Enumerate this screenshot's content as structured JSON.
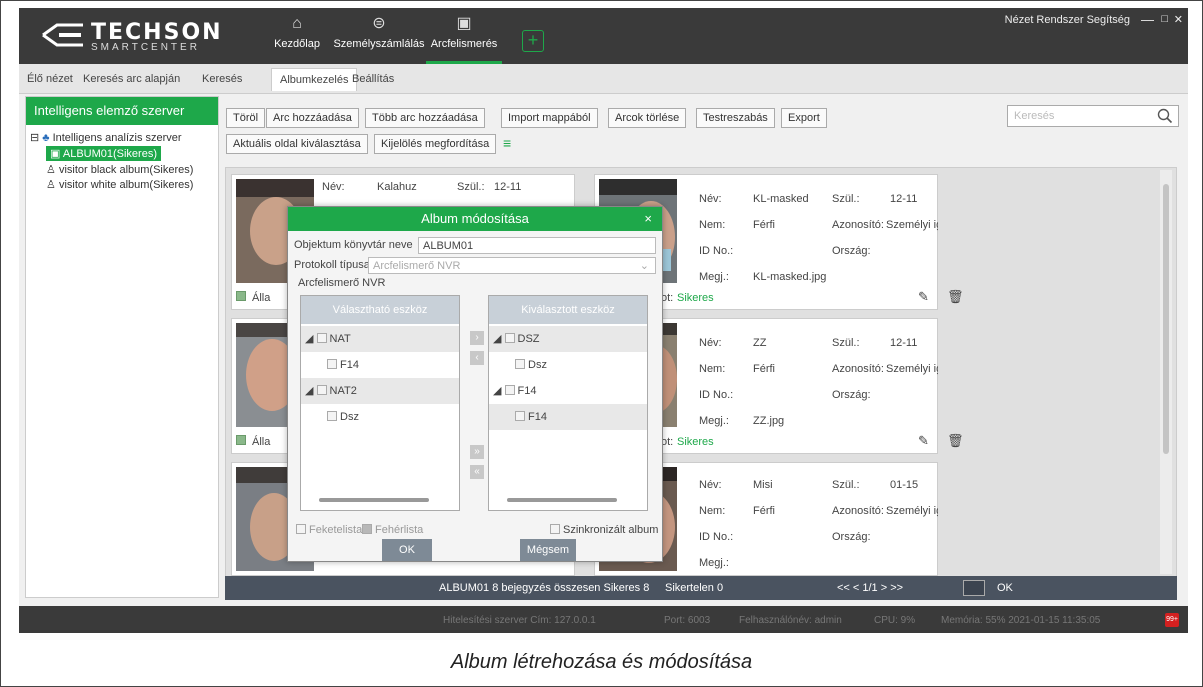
{
  "header": {
    "logo_main": "TECHSON",
    "logo_sub": "SMARTCENTER",
    "nav": [
      {
        "label": "Kezdőlap",
        "icon": "home-icon"
      },
      {
        "label": "Személyszámlálás",
        "icon": "people-count-icon"
      },
      {
        "label": "Arcfelismerés",
        "icon": "face-recognition-icon"
      }
    ],
    "menu": "Nézet  Rendszer  Segítség",
    "min": "—",
    "max": "□",
    "close": "✕"
  },
  "tabs": [
    "Élő nézet",
    "Keresés arc alapján",
    "Keresés",
    "Albumkezelés",
    "Beállítás"
  ],
  "sidebar": {
    "title": "Intelligens elemző szerver",
    "server": "Intelligens analízis szerver",
    "albums": [
      "ALBUM01(Sikeres)",
      "visitor black album(Sikeres)",
      "visitor white album(Sikeres)"
    ]
  },
  "toolbar": {
    "row1": [
      "Töröl",
      "Arc hozzáadása",
      "Több arc hozzáadása",
      "Import mappából",
      "Arcok törlése",
      "Testreszabás",
      "Export"
    ],
    "row2": [
      "Aktuális oldal kiválasztása",
      "Kijelölés megfordítása"
    ],
    "search_placeholder": "Keresés"
  },
  "cards": [
    {
      "name_label": "Név:",
      "name": "Kalahuz",
      "szul_label": "Szül.:",
      "szul": "12-11",
      "status_label": "Álla",
      "status_value": ""
    },
    {
      "name_label": "Név:",
      "name": "KL-masked",
      "szul_label": "Szül.:",
      "szul": "12-11",
      "nem_label": "Nem:",
      "nem": "Férfi",
      "azon_label": "Azonosító:",
      "azon": "Személyi igazolv",
      "id_label": "ID No.:",
      "orszag_label": "Ország:",
      "megj_label": "Megj.:",
      "megj": "KL-masked.jpg",
      "status_label": "ot:",
      "status_value": "Sikeres"
    },
    {
      "name_label": "",
      "name": "",
      "status_label": "Álla",
      "status_value": ""
    },
    {
      "name_label": "Név:",
      "name": "ZZ",
      "szul_label": "Szül.:",
      "szul": "12-11",
      "nem_label": "Nem:",
      "nem": "Férfi",
      "azon_label": "Azonosító:",
      "azon": "Személyi igazolv",
      "id_label": "ID No.:",
      "orszag_label": "Ország:",
      "megj_label": "Megj.:",
      "megj": "ZZ.jpg",
      "status_label": "ot:",
      "status_value": "Sikeres"
    },
    {
      "name_label": "Név:",
      "name": "Misi",
      "szul_label": "Szül.:",
      "szul": "01-15",
      "nem_label": "Nem:",
      "nem": "Férfi",
      "azon_label": "Azonosító:",
      "azon": "Személyi igazolv",
      "id_label": "ID No.:",
      "orszag_label": "Ország:",
      "megj_label": "Megj.:"
    }
  ],
  "statusbar": {
    "summary": "ALBUM01  8 bejegyzés összesen  Sikeres 8",
    "failed": "Sikertelen 0",
    "pager": "<<   <   1/1   >   >>",
    "ok": "OK"
  },
  "footer": {
    "server": "Hitelesítési szerver Cím: 127.0.0.1",
    "port": "Port: 6003",
    "user": "Felhasználónév: admin",
    "cpu": "CPU: 9%",
    "mem": "Memória: 55%   2021-01-15 11:35:05",
    "badge": "99+"
  },
  "modal": {
    "title": "Album módosítása",
    "close": "×",
    "lib_label": "Objektum könyvtár neve",
    "lib_value": "ALBUM01",
    "proto_label": "Protokoll típusa",
    "proto_value": "Arcfelismerő NVR",
    "section": "Arcfelismerő NVR",
    "left_header": "Választható eszköz",
    "right_header": "Kiválasztott eszköz",
    "left_items": [
      {
        "label": "NAT",
        "group": true
      },
      {
        "label": "F14",
        "group": false
      },
      {
        "label": "NAT2",
        "group": true
      },
      {
        "label": "Dsz",
        "group": false
      }
    ],
    "right_items": [
      {
        "label": "DSZ",
        "group": true
      },
      {
        "label": "Dsz",
        "group": false
      },
      {
        "label": "F14",
        "group": true
      },
      {
        "label": "F14",
        "group": false
      }
    ],
    "blacklist": "Feketelista",
    "whitelist": "Fehérlista",
    "sync": "Szinkronizált album",
    "ok": "OK",
    "cancel": "Mégsem"
  },
  "caption": "Album létrehozása és módosítása",
  "colors": {
    "accent": "#1ea84a",
    "header": "#3a3a3a",
    "statusbar": "#4a5360"
  }
}
